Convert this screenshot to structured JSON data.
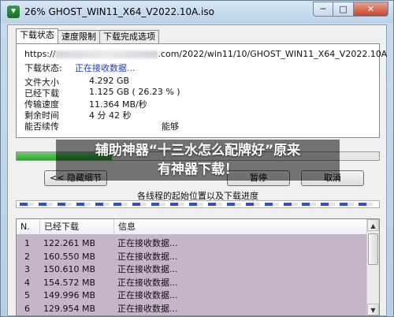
{
  "window": {
    "title": "26% GHOST_WIN11_X64_V2022.10A.iso",
    "min": "─",
    "max": "□",
    "close": "✕"
  },
  "tabs": [
    "下载状态",
    "速度限制",
    "下载完成选项"
  ],
  "status": {
    "url_prefix": "https://",
    "url_suffix": ".com/2022/win11/10/GHOST_WIN11_X64_V2022.10A",
    "rows": [
      {
        "label": "下载状态:",
        "value": "正在接收数据..."
      },
      {
        "label": "文件大小",
        "value": "4.292  GB"
      },
      {
        "label": "已经下载",
        "value": "1.125  GB  ( 26.23 % )"
      },
      {
        "label": "传输速度",
        "value": "11.364  MB/秒"
      },
      {
        "label": "剩余时间",
        "value": "4 分 42 秒"
      },
      {
        "label": "能否续传",
        "value": "能够"
      }
    ]
  },
  "progress": {
    "fraction": 0.2623
  },
  "buttons": {
    "hide_details": "<< 隐藏细节",
    "pause": "暂停",
    "cancel": "取消"
  },
  "threads": {
    "title": "各线程的起始位置以及下载进度",
    "count": 19
  },
  "list": {
    "headers": [
      "N.",
      "已经下载",
      "信息"
    ],
    "rows": [
      [
        "1",
        "122.261  MB",
        "正在接收数据..."
      ],
      [
        "2",
        "160.550  MB",
        "正在接收数据..."
      ],
      [
        "3",
        "150.610  MB",
        "正在接收数据..."
      ],
      [
        "4",
        "154.572  MB",
        "正在接收数据..."
      ],
      [
        "5",
        "149.996  MB",
        "正在接收数据..."
      ],
      [
        "6",
        "129.954  MB",
        "正在接收数据..."
      ]
    ]
  },
  "overlay": {
    "line1": "辅助神器“十三水怎么配牌好”原来",
    "line2": "有神器下载！"
  },
  "colors": {
    "progress": "#2fa32f",
    "thread_progress": "#2a4fcf",
    "list_bg": "#c6b4c9",
    "status_text": "#1a3fb0"
  }
}
